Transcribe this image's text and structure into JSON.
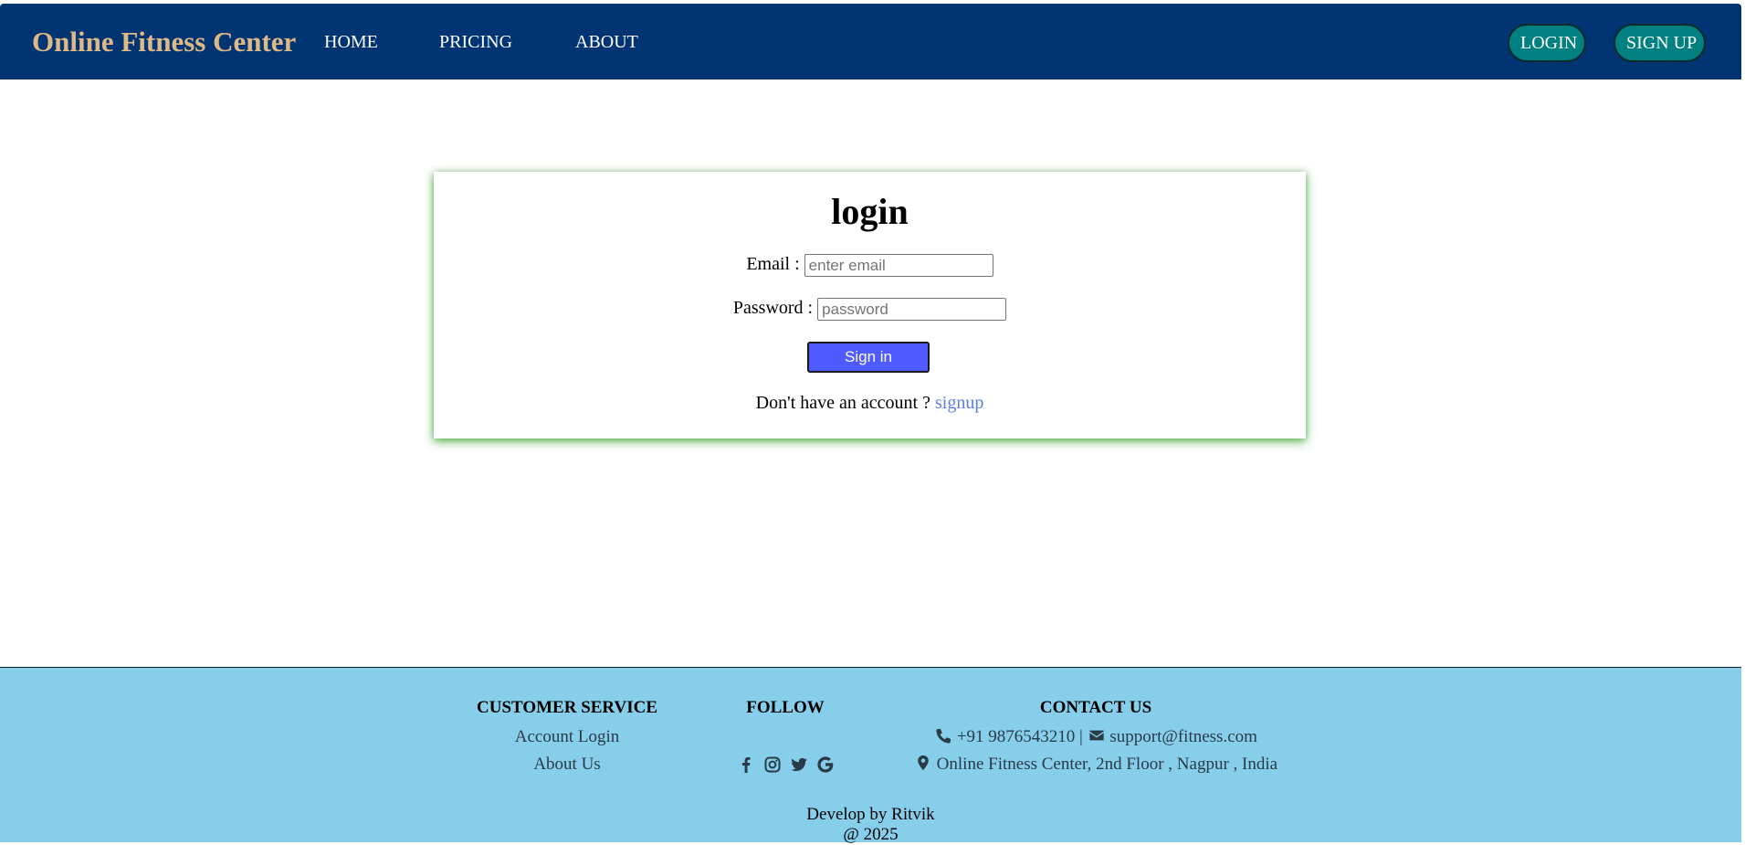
{
  "header": {
    "brand": "Online Fitness Center",
    "nav": {
      "home": "HOME",
      "pricing": "PRICING",
      "about": "ABOUT"
    },
    "login_label": "LOGIN",
    "signup_label": "SIGN UP"
  },
  "login": {
    "title": "login",
    "email_label": "Email :",
    "email_placeholder": "enter email",
    "password_label": "Password :",
    "password_placeholder": "password",
    "submit_label": "Sign in",
    "no_account_text": "Don't have an account ?",
    "signup_link": "signup"
  },
  "footer": {
    "service_heading": "CUSTOMER SERVICE",
    "service_links": [
      "Account Login",
      "About Us"
    ],
    "follow_heading": "FOLLOW",
    "social_icons": [
      "facebook-icon",
      "instagram-icon",
      "twitter-icon",
      "google-icon"
    ],
    "contact_heading": "CONTACT US",
    "phone": "+91 9876543210",
    "separator": "|",
    "email": "support@fitness.com",
    "address": "Online Fitness Center, 2nd Floor , Nagpur , India",
    "credit": "Develop by Ritvik",
    "year": "@ 2025"
  },
  "colors": {
    "header_bg": "#003472",
    "brand": "#deb887",
    "pill_button": "#008080",
    "signin_button": "#4f5bff",
    "signup_link": "#5a7dea",
    "footer_bg": "#87ceeb",
    "card_shadow": "#3caa32"
  }
}
